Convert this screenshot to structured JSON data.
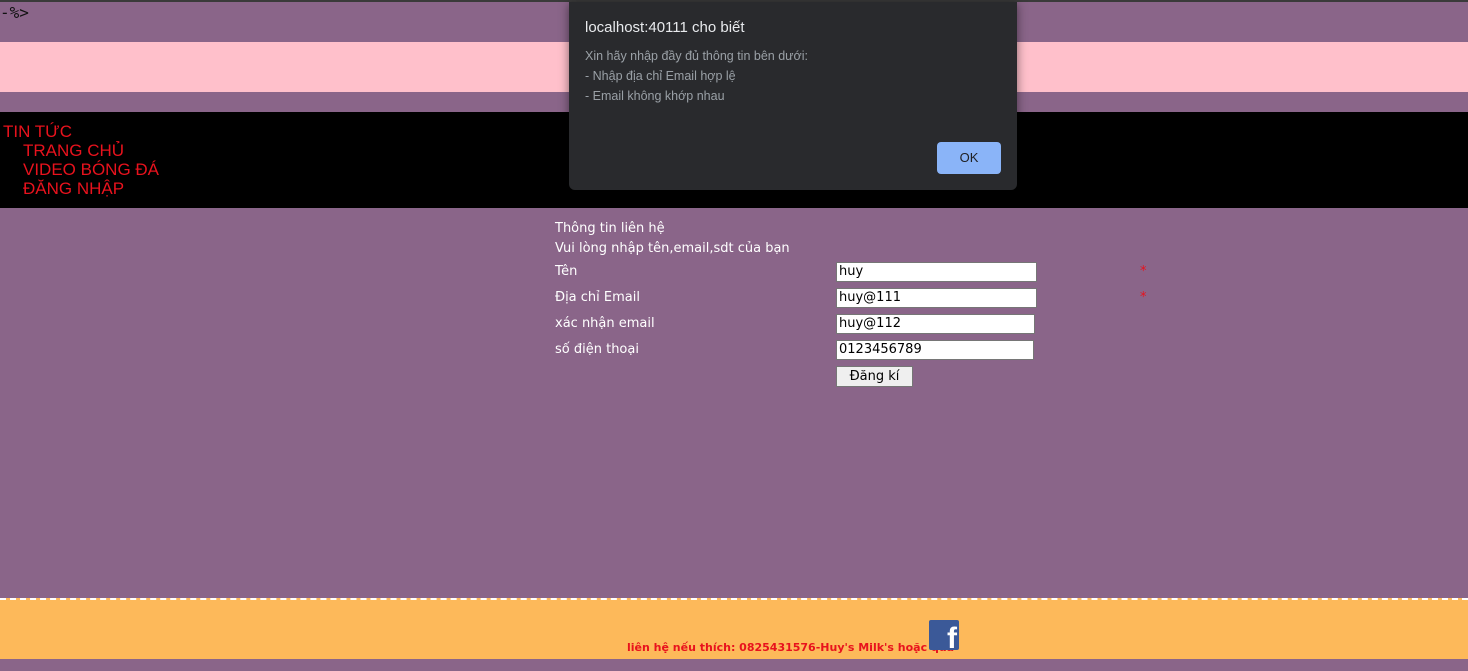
{
  "page": {
    "stray_text": "-%>",
    "nav": {
      "title": "TIN TỨC",
      "items": [
        "TRANG CHỦ",
        "VIDEO BÓNG ĐÁ",
        "ĐĂNG NHẬP"
      ]
    },
    "form": {
      "heading": "Thông tin liên hệ",
      "subheading": "Vui lòng nhập tên,email,sdt của bạn",
      "fields": [
        {
          "label": "Tên",
          "value": "huy",
          "required": true
        },
        {
          "label": "Địa chỉ Email",
          "value": "huy@111",
          "required": true
        },
        {
          "label": "xác nhận email",
          "value": "huy@112",
          "required": false
        },
        {
          "label": "số điện thoại",
          "value": "0123456789",
          "required": false
        }
      ],
      "required_mark": "*",
      "submit_label": "Đăng kí"
    },
    "footer": {
      "text": "liên hệ nếu thích: 0825431576-Huy's Milk's hoặc qua",
      "icon": "facebook-icon"
    }
  },
  "dialog": {
    "title": "localhost:40111 cho biết",
    "message_lines": [
      "Xin hãy nhập đầy đủ thông tin bên dưới:",
      "- Nhập địa chỉ Email hợp lệ",
      "- Email không khớp nhau"
    ],
    "ok_label": "OK"
  },
  "colors": {
    "background": "#8a6589",
    "pink_bar": "#ffc0cb",
    "nav_bg": "#000000",
    "nav_text": "#e8121d",
    "footer_bg": "#fdb95a",
    "dialog_bg": "#292a2d",
    "dialog_button": "#8ab4f8"
  }
}
